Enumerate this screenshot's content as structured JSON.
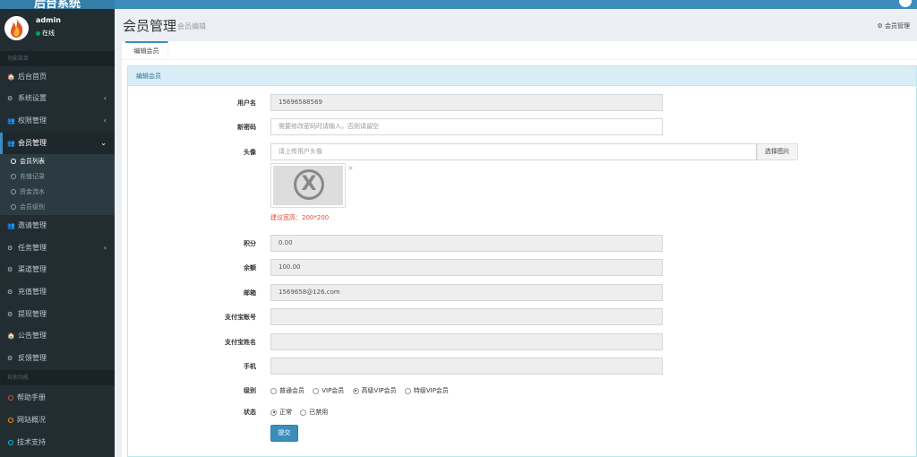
{
  "app": {
    "title": "后台系统"
  },
  "user": {
    "name": "admin",
    "status": "在线"
  },
  "sidebar": {
    "header_main": "功能菜单",
    "items": [
      {
        "icon": "home-icon",
        "glyph": "🏠",
        "label": "后台首页"
      },
      {
        "icon": "cogs-icon",
        "glyph": "⚙",
        "label": "系统设置",
        "caret": "‹"
      },
      {
        "icon": "users-icon",
        "glyph": "👥",
        "label": "权限管理",
        "caret": "‹"
      },
      {
        "icon": "users-icon",
        "glyph": "👥",
        "label": "会员管理",
        "caret": "⌄"
      },
      {
        "icon": "users-icon",
        "glyph": "👥",
        "label": "邀请管理"
      },
      {
        "icon": "cogs-icon",
        "glyph": "⚙",
        "label": "任务管理",
        "caret": "‹"
      },
      {
        "icon": "cogs-icon",
        "glyph": "⚙",
        "label": "渠道管理"
      },
      {
        "icon": "cogs-icon",
        "glyph": "⚙",
        "label": "充值管理"
      },
      {
        "icon": "cogs-icon",
        "glyph": "⚙",
        "label": "提现管理"
      },
      {
        "icon": "home-icon",
        "glyph": "🏠",
        "label": "公告管理"
      },
      {
        "icon": "cogs-icon",
        "glyph": "⚙",
        "label": "反馈管理"
      }
    ],
    "submenu": [
      {
        "label": "会员列表"
      },
      {
        "label": "充值记录"
      },
      {
        "label": "资金流水"
      },
      {
        "label": "会员级别"
      }
    ],
    "header_other": "其他功能",
    "other": [
      {
        "label": "帮助手册",
        "color": "#dd4b39"
      },
      {
        "label": "网站概况",
        "color": "#f39c12"
      },
      {
        "label": "技术支持",
        "color": "#00c0ef"
      }
    ]
  },
  "header": {
    "title": "会员管理",
    "subtitle": "会员编辑",
    "breadcrumb": "会员管理"
  },
  "tabs": [
    {
      "label": "编辑会员"
    }
  ],
  "panel": {
    "title": "编辑会员"
  },
  "form": {
    "username": {
      "label": "用户名",
      "value": "15696588569"
    },
    "password": {
      "label": "新密码",
      "placeholder": "需要修改密码时请输入，否则请留空"
    },
    "avatar": {
      "label": "头像",
      "placeholder": "请上传用户头像",
      "button": "选择图片",
      "hint": "建议宽高：200*200",
      "remove": "×"
    },
    "points": {
      "label": "积分",
      "value": "0.00"
    },
    "balance": {
      "label": "余额",
      "value": "100.00"
    },
    "email": {
      "label": "邮箱",
      "value": "1569658@126.com"
    },
    "alipay_account": {
      "label": "支付宝账号",
      "value": ""
    },
    "alipay_name": {
      "label": "支付宝姓名",
      "value": ""
    },
    "phone": {
      "label": "手机",
      "value": ""
    },
    "level": {
      "label": "级别",
      "options": [
        "普通会员",
        "VIP会员",
        "高级VIP会员",
        "特级VIP会员"
      ],
      "selected": "高级VIP会员"
    },
    "status": {
      "label": "状态",
      "options": [
        "正常",
        "已禁用"
      ],
      "selected": "正常"
    },
    "submit": "提交"
  },
  "colors": {
    "primary": "#3c8dbc",
    "sidebar_bg": "#222d32",
    "panel_heading_bg": "#d9edf7",
    "hint_red": "#dd4b39"
  }
}
